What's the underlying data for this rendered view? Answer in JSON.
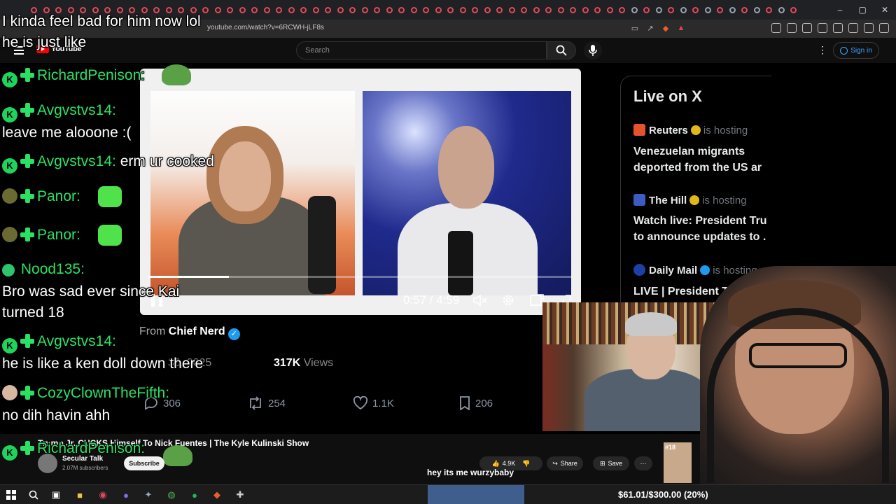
{
  "browser": {
    "url": "youtube.com/watch?v=6RCWH-jLF8s",
    "window_controls": [
      "–",
      "▢",
      "✕"
    ]
  },
  "youtube": {
    "logo_text": "YouTube",
    "search_placeholder": "Search",
    "signin_label": "Sign in"
  },
  "video": {
    "time": "0:57 / 4:59",
    "progress_fraction": 0.19
  },
  "x_post": {
    "from_prefix": "From",
    "author": "Chief Nerd",
    "date": "30, 2025",
    "views_count": "317K",
    "views_label": "Views",
    "replies": "306",
    "reposts": "254",
    "likes": "1.1K",
    "bookmarks": "206"
  },
  "live_on_x": {
    "title": "Live on X",
    "entries": [
      {
        "host": "Reuters",
        "hosting": "is hosting",
        "headline1": "Venezuelan migrants",
        "headline2": "deported from the US ar",
        "color": "#e5532d"
      },
      {
        "host": "The Hill",
        "hosting": "is hosting",
        "headline1": "Watch live: President Tru",
        "headline2": "to announce updates to .",
        "color": "#3f5bc1"
      },
      {
        "host": "Daily Mail",
        "hosting": "is hosting",
        "headline1": "LIVE | President Trum",
        "headline2": "",
        "color": "#1f3fa8"
      }
    ]
  },
  "chat": [
    {
      "text": "I kinda feel bad for him now lol"
    },
    {
      "text": "he is just like"
    },
    {
      "name": "RichardPenison:"
    },
    {
      "name": "Avgvstvs14:"
    },
    {
      "text": "leave me alooone :("
    },
    {
      "name": "Avgvstvs14:",
      "text": "erm ur cooked"
    },
    {
      "name": "Panor:"
    },
    {
      "name": "Panor:"
    },
    {
      "name": "Nood135:"
    },
    {
      "text": "Bro was sad ever since Kai"
    },
    {
      "text": "turned 18"
    },
    {
      "name": "Avgvstvs14:"
    },
    {
      "text": "he is like a ken doll down there"
    },
    {
      "name": "CozyClownTheFifth:"
    },
    {
      "text": "no dih havin ahh"
    },
    {
      "name": "RichardPenison:"
    }
  ],
  "yt_below": {
    "title": "Trump Jr. CUCKS Himself To Nick Fuentes | The Kyle Kulinski Show",
    "channel": "Secular Talk",
    "subscribers": "2.07M subscribers",
    "subscribe": "Subscribe",
    "likes": "4.9K",
    "share": "Share",
    "save": "Save",
    "more": "···",
    "thumb_badge": "#18"
  },
  "overlay_text": "hey its me wurzybaby",
  "taskbar": {
    "goal": "$61.01/$300.00 (20%)"
  },
  "colors": {
    "chat_name": "#29e264",
    "verified": "#1d9bf0",
    "youtube_red": "#ff0000"
  }
}
